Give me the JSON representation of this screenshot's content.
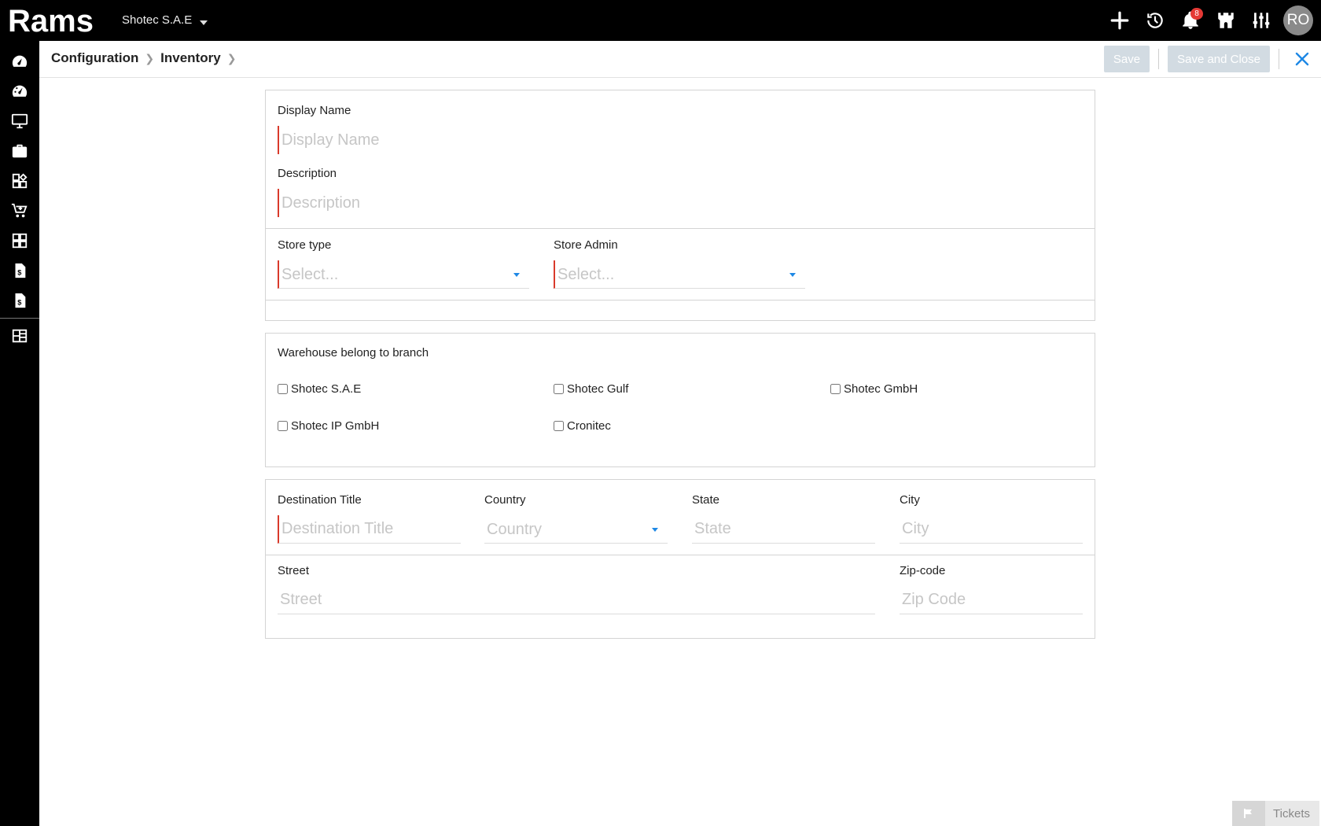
{
  "app": {
    "logo_text": "Rams",
    "company": "Shotec S.A.E",
    "notifications_count": "8",
    "user_initials": "RO"
  },
  "topbar_icons": [
    "plus-icon",
    "history-icon",
    "bell-icon",
    "castle-icon",
    "sliders-icon"
  ],
  "sidebar_icons": [
    "dashboard-icon",
    "dashboard-alt-icon",
    "monitor-icon",
    "briefcase-icon",
    "modules-icon",
    "cart-icon",
    "modules-alt-icon",
    "invoice-icon",
    "invoice-alt-icon",
    "layout-icon"
  ],
  "breadcrumb": [
    "Configuration",
    "Inventory"
  ],
  "toolbar": {
    "save_label": "Save",
    "save_close_label": "Save and Close"
  },
  "form": {
    "display_name": {
      "label": "Display Name",
      "placeholder": "Display Name"
    },
    "description": {
      "label": "Description",
      "placeholder": "Description"
    },
    "store_type": {
      "label": "Store type",
      "placeholder": "Select..."
    },
    "store_admin": {
      "label": "Store Admin",
      "placeholder": "Select..."
    }
  },
  "branches": {
    "title": "Warehouse belong to branch",
    "items": [
      {
        "label": "Shotec S.A.E",
        "checked": false
      },
      {
        "label": "Shotec Gulf",
        "checked": false
      },
      {
        "label": "Shotec GmbH",
        "checked": false
      },
      {
        "label": "Shotec IP GmbH",
        "checked": false
      },
      {
        "label": "Cronitec",
        "checked": false
      }
    ]
  },
  "address": {
    "destination_title": {
      "label": "Destination Title",
      "placeholder": "Destination Title"
    },
    "country": {
      "label": "Country",
      "placeholder": "Country"
    },
    "state": {
      "label": "State",
      "placeholder": "State"
    },
    "city": {
      "label": "City",
      "placeholder": "City"
    },
    "street": {
      "label": "Street",
      "placeholder": "Street"
    },
    "zip": {
      "label": "Zip-code",
      "placeholder": "Zip Code"
    }
  },
  "footer": {
    "tickets_label": "Tickets"
  },
  "colors": {
    "topbar": "#000000",
    "required_marker": "#d93a2b",
    "dropdown_caret": "#1e88e5",
    "disabled_button": "#d2dbe2",
    "close_icon": "#1e88e5",
    "badge": "#e53935"
  }
}
